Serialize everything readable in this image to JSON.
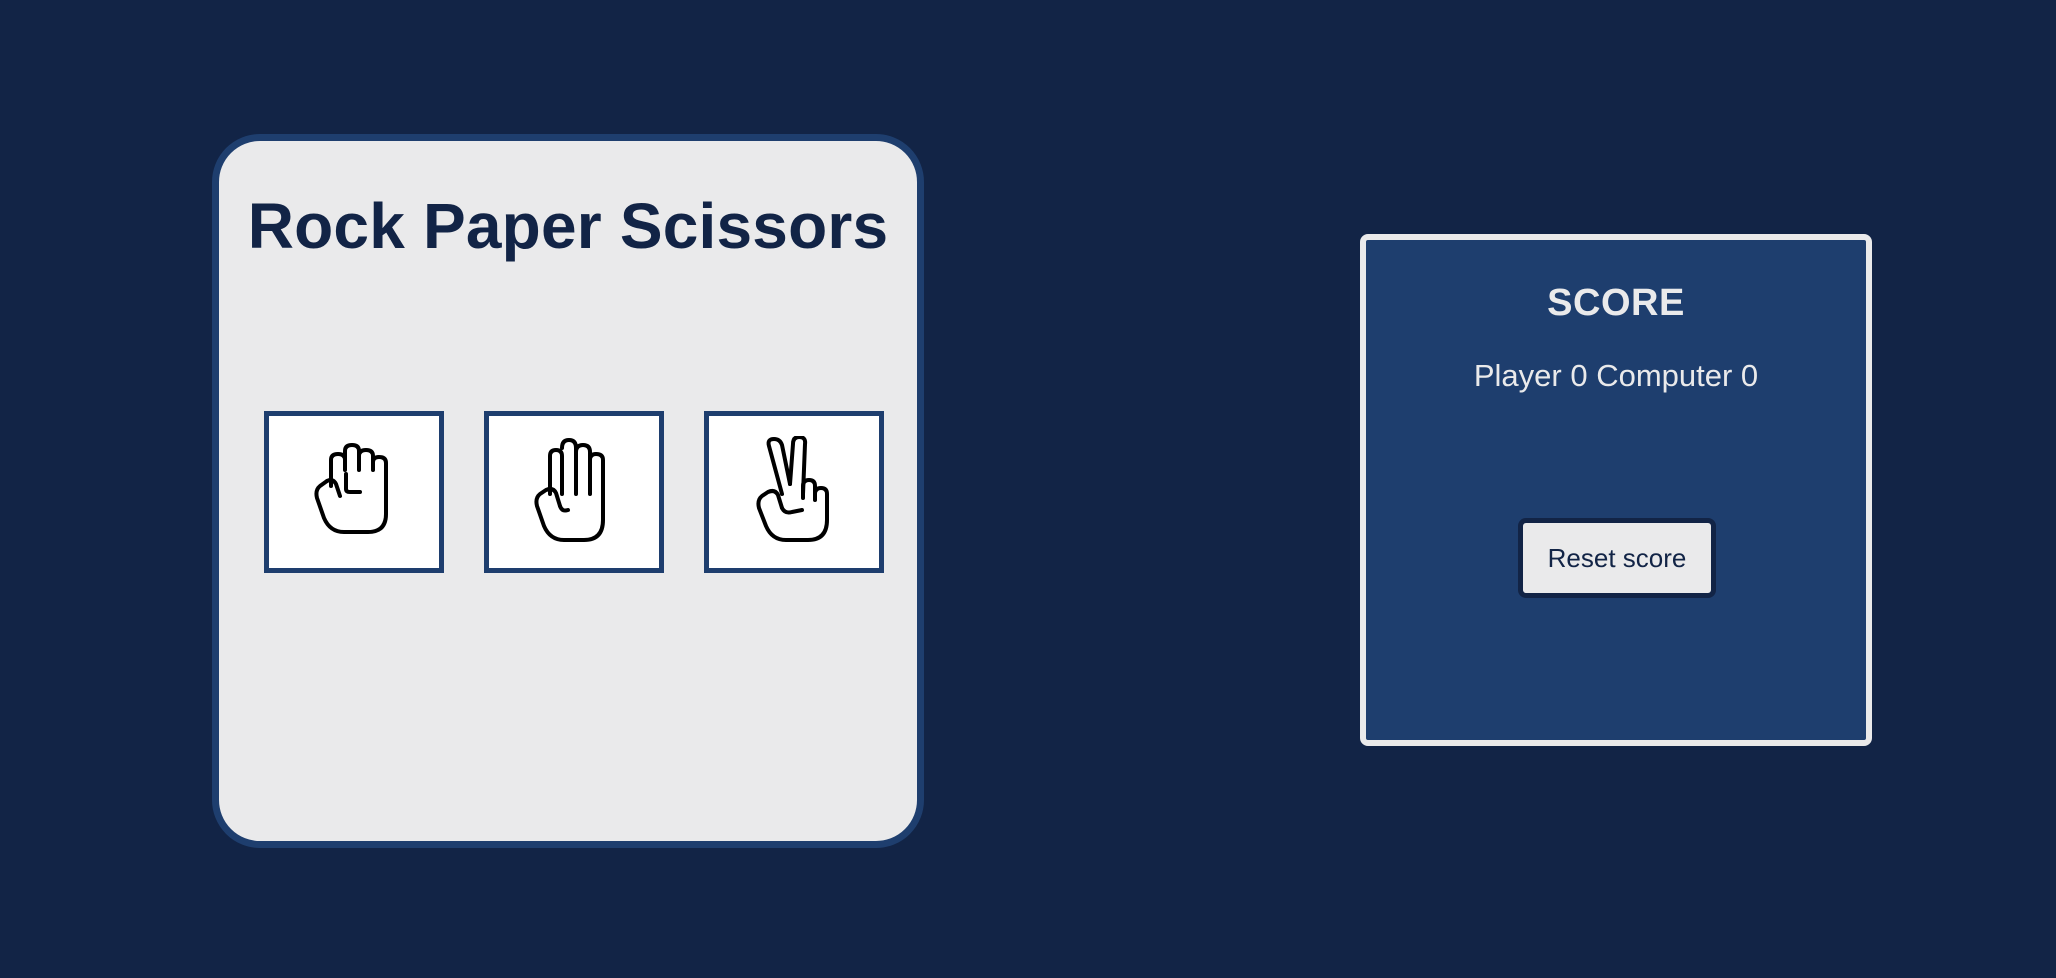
{
  "game": {
    "title": "Rock Paper Scissors",
    "choices": [
      {
        "id": "rock",
        "icon": "fist-hand-icon"
      },
      {
        "id": "paper",
        "icon": "open-hand-icon"
      },
      {
        "id": "scissors",
        "icon": "peace-hand-icon"
      }
    ]
  },
  "score": {
    "heading": "SCORE",
    "player_label": "Player",
    "player_value": "0",
    "computer_label": "Computer",
    "computer_value": "0",
    "reset_label": "Reset score"
  },
  "colors": {
    "background": "#122446",
    "panel": "#eaeaeb",
    "accent": "#1e3e6e"
  }
}
